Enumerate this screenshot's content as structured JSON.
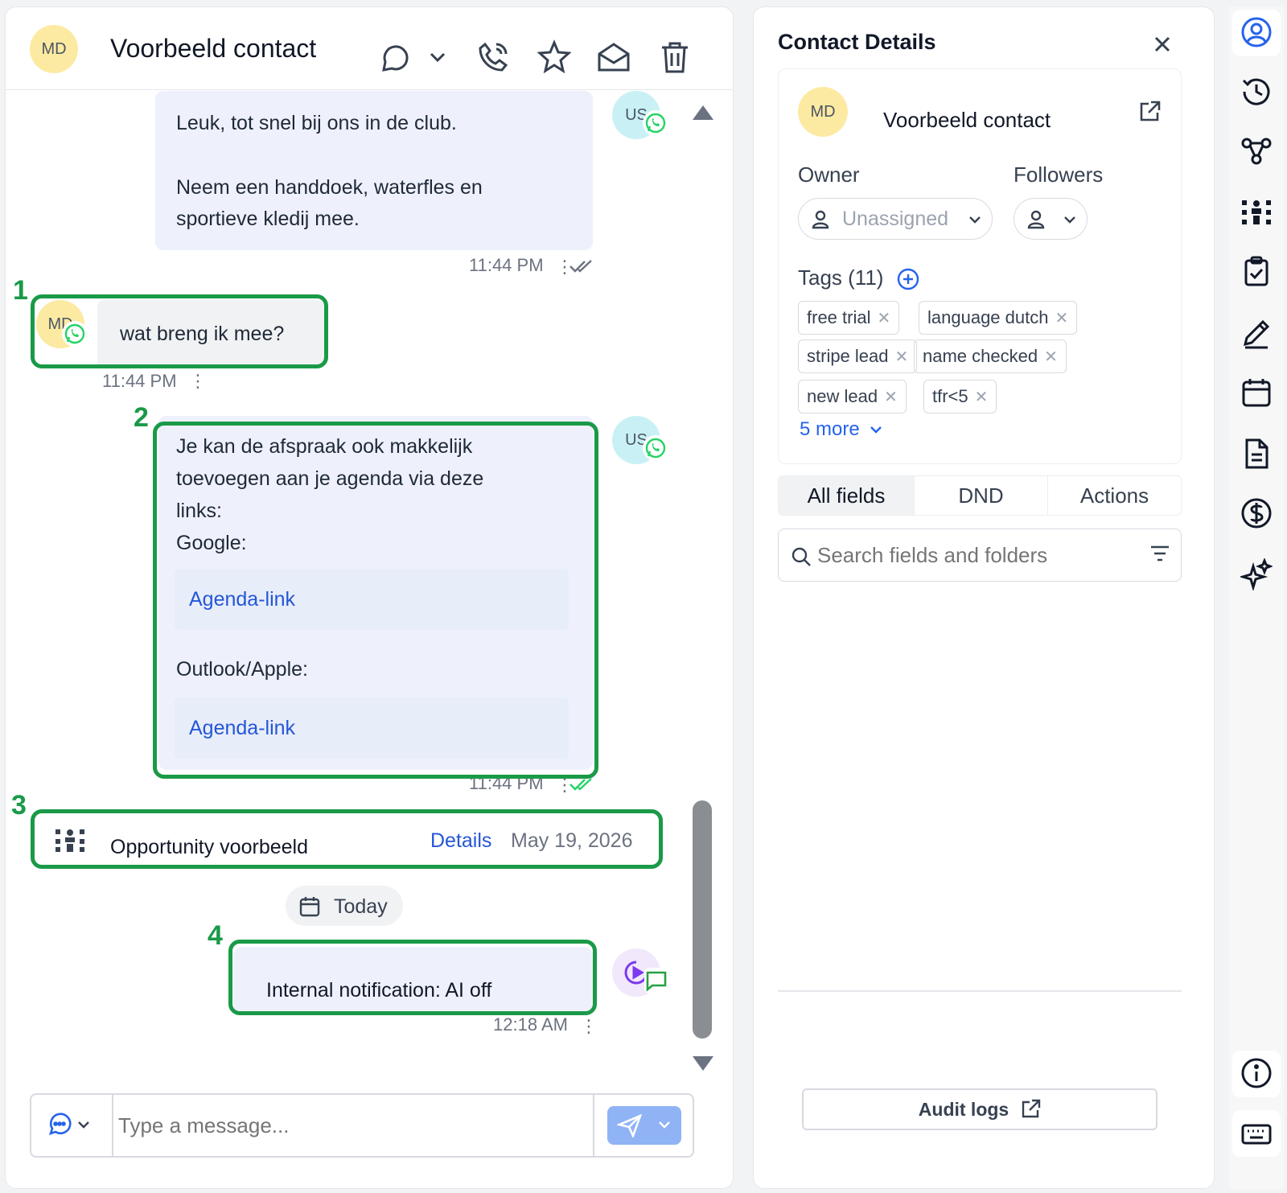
{
  "header": {
    "avatar_initials": "MD",
    "contact_name": "Voorbeeld contact"
  },
  "messages": {
    "m1": {
      "avatar": "US",
      "line1": "Leuk, tot snel bij ons in de club.",
      "line2": "Neem een handdoek, waterfles en",
      "line3": "sportieve kledij mee.",
      "time": "11:44 PM"
    },
    "m2": {
      "avatar": "MD",
      "text": "wat breng ik mee?",
      "time": "11:44 PM"
    },
    "m3": {
      "avatar": "US",
      "line1": "Je kan de afspraak ook makkelijk",
      "line2": "toevoegen aan je agenda via deze",
      "line3": "links:",
      "google_label": "Google:",
      "link1": "Agenda-link",
      "outlook_label": "Outlook/Apple:",
      "link2": "Agenda-link",
      "time": "11:44 PM"
    },
    "opportunity": {
      "title": "Opportunity voorbeeld",
      "details_link": "Details",
      "date": "May 19, 2026"
    },
    "date_divider": "Today",
    "m4": {
      "text": "Internal notification: AI off",
      "time": "12:18 AM"
    }
  },
  "annotations": [
    "1",
    "2",
    "3",
    "4"
  ],
  "composer": {
    "placeholder": "Type a message..."
  },
  "details": {
    "title": "Contact Details",
    "avatar_initials": "MD",
    "contact_name": "Voorbeeld contact",
    "owner_label": "Owner",
    "owner_value": "Unassigned",
    "followers_label": "Followers",
    "tags_label": "Tags (11)",
    "tags": [
      "free trial",
      "language dutch",
      "stripe lead",
      "name checked",
      "new lead",
      "tfr<5"
    ],
    "more_link": "5 more",
    "tabs": [
      "All fields",
      "DND",
      "Actions"
    ],
    "search_placeholder": "Search fields and folders",
    "audit_logs": "Audit logs"
  },
  "colors": {
    "annotation": "#1a9a48",
    "link": "#2456d6",
    "send_button": "#8fb3f5",
    "rail_active": "#2563eb"
  },
  "icons": [
    "conversation-icon",
    "phone-icon",
    "star-icon",
    "mail-icon",
    "trash-icon",
    "whatsapp-icon",
    "calendar-icon",
    "opportunity-icon",
    "ai-bot-icon",
    "chat-type-icon",
    "send-icon",
    "close-icon",
    "external-link-icon",
    "user-icon",
    "add-circle-icon",
    "filter-icon",
    "contact-icon",
    "history-icon",
    "workflow-icon",
    "task-icon",
    "notes-icon",
    "document-icon",
    "payment-icon",
    "sparkle-icon",
    "info-icon",
    "keyboard-icon"
  ]
}
